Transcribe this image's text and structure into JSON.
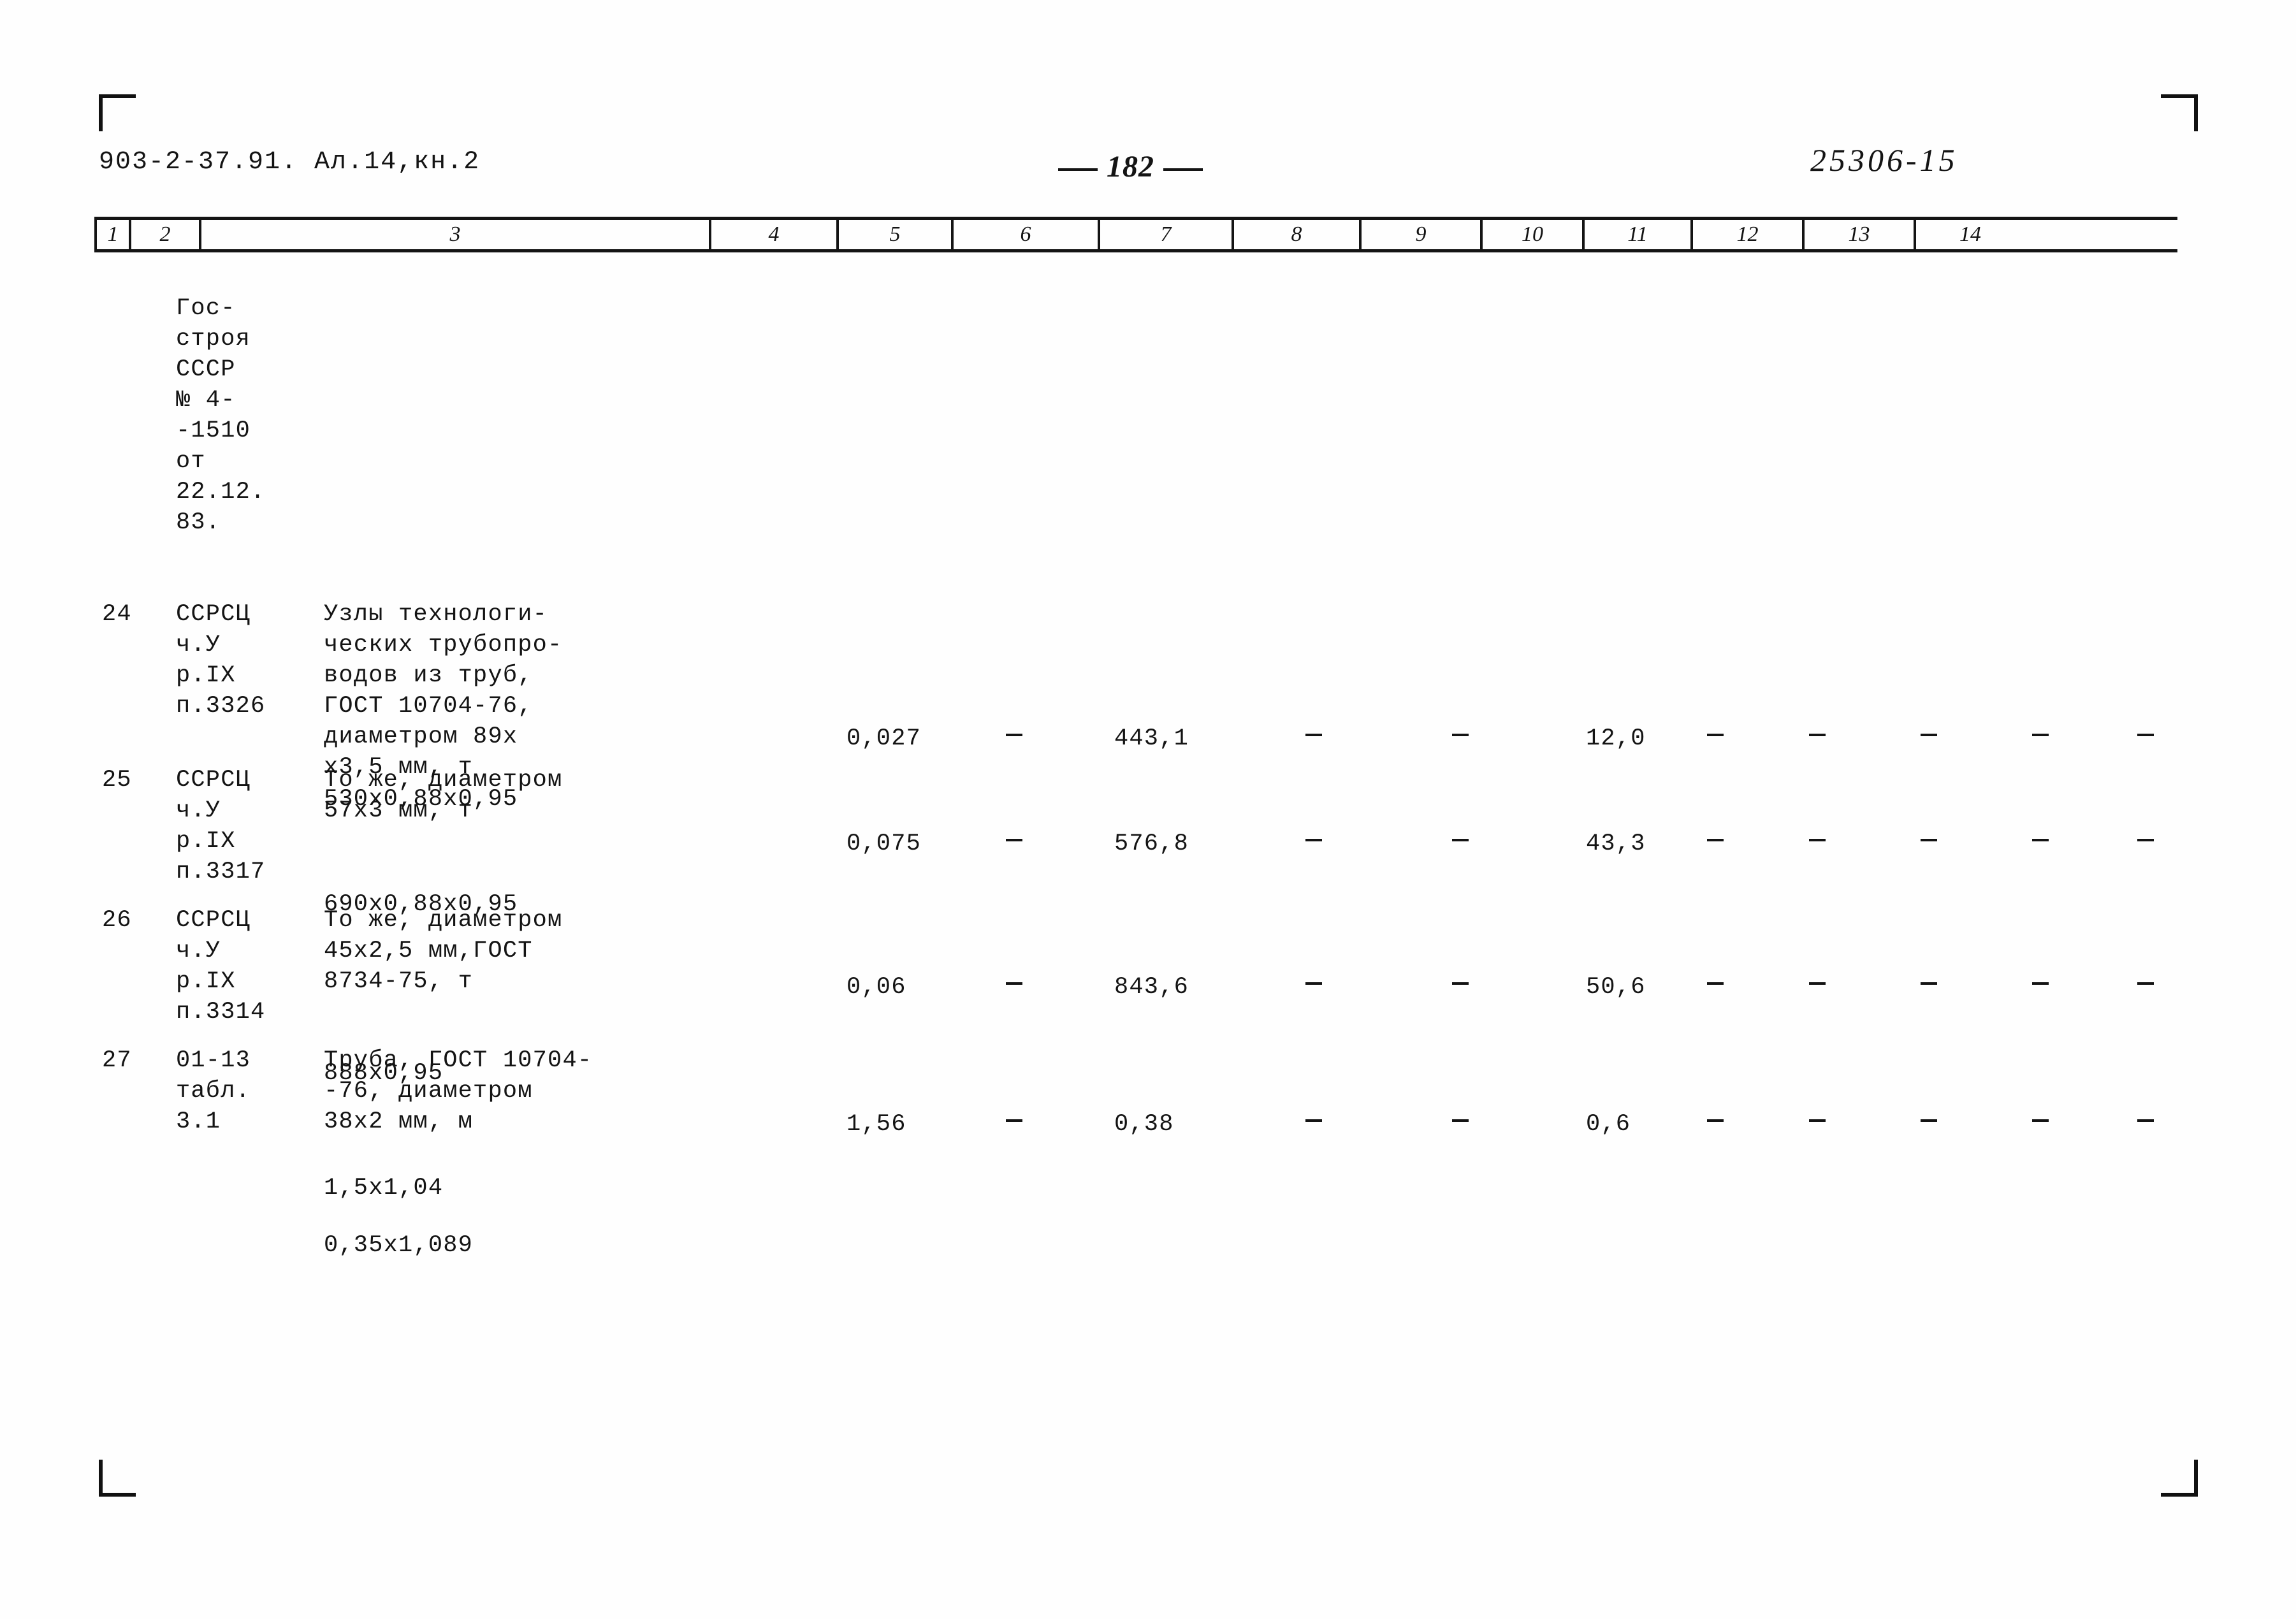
{
  "header": {
    "doc_code": "903-2-37.91. Ал.14,кн.2",
    "page_number": "182",
    "hand_code": "25306-15"
  },
  "table": {
    "column_numbers": [
      "1",
      "2",
      "3",
      "4",
      "5",
      "6",
      "7",
      "8",
      "9",
      "10",
      "11",
      "12",
      "13",
      "14"
    ],
    "rows": [
      {
        "num": "",
        "code": "Гос-\nстроя\nСССР\n№ 4-\n-1510\nот\n22.12.\n83.",
        "desc": "",
        "col4": "",
        "col5": "",
        "col6": "",
        "col7": "",
        "col8": "",
        "col9": "",
        "col10": "",
        "col11": "",
        "col12": "",
        "col13": "",
        "col14": ""
      },
      {
        "num": "24",
        "code": "ССРСЦ\nч.У\nр.IX\nп.3326",
        "desc": "Узлы технологи-\nческих трубопро-\nводов из труб,\nГОСТ 10704-76,\nдиаметром 89х\nх3,5 мм,    т",
        "desc_extra": "530х0,88х0,95",
        "col4": "0,027",
        "col5": "—",
        "col6": "443,1",
        "col7": "—",
        "col8": "—",
        "col9": "12,0",
        "col10": "—",
        "col11": "—",
        "col12": "—",
        "col13": "—",
        "col14": "—"
      },
      {
        "num": "25",
        "code": "ССРСЦ\nч.У\nр.IX\nп.3317",
        "desc": "То же, диаметром\n57х3 мм,    т",
        "desc_extra": "690х0,88х0,95",
        "col4": "0,075",
        "col5": "—",
        "col6": "576,8",
        "col7": "—",
        "col8": "—",
        "col9": "43,3",
        "col10": "—",
        "col11": "—",
        "col12": "—",
        "col13": "—",
        "col14": "—"
      },
      {
        "num": "26",
        "code": "ССРСЦ\nч.У\nр.IX\nп.3314",
        "desc": "То же, диаметром\n45х2,5 мм,ГОСТ\n8734-75,    т",
        "desc_extra": "888х0,95",
        "col4": "0,06",
        "col5": "—",
        "col6": "843,6",
        "col7": "—",
        "col8": "—",
        "col9": "50,6",
        "col10": "—",
        "col11": "—",
        "col12": "—",
        "col13": "—",
        "col14": "—"
      },
      {
        "num": "27",
        "code": "01-13\nтабл.\n3.1",
        "desc": "Труба, ГОСТ 10704-\n-76, диаметром\n38х2 мм,    м",
        "desc_extra": "1,5х1,04",
        "desc_extra2": "0,35х1,089",
        "col4": "1,56",
        "col5": "—",
        "col6": "0,38",
        "col7": "—",
        "col8": "—",
        "col9": "0,6",
        "col10": "—",
        "col11": "—",
        "col12": "—",
        "col13": "—",
        "col14": "—"
      }
    ]
  }
}
